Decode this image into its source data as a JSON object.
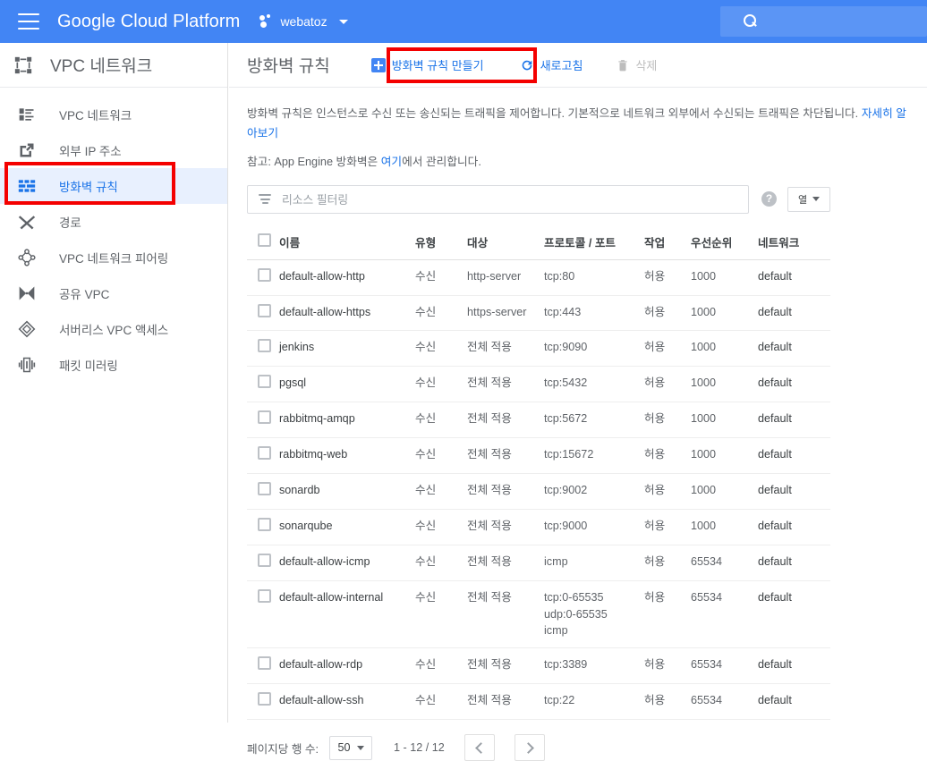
{
  "topbar": {
    "menu_icon": "hamburger-icon",
    "brand": "Google Cloud Platform",
    "project_icon": "project-dots-icon",
    "project_name": "webatoz",
    "project_caret": "chevron-down-icon",
    "search_icon": "search-icon",
    "search_value": "",
    "search_placeholder": ""
  },
  "sidebar": {
    "header_icon": "vpc-network-icon",
    "header_title": "VPC 네트워크",
    "items": [
      {
        "label": "VPC 네트워크",
        "icon": "vpc-network-list-icon",
        "selected": false
      },
      {
        "label": "외부 IP 주소",
        "icon": "external-ip-icon",
        "selected": false
      },
      {
        "label": "방화벽 규칙",
        "icon": "firewall-rules-icon",
        "selected": true
      },
      {
        "label": "경로",
        "icon": "routes-icon",
        "selected": false
      },
      {
        "label": "VPC 네트워크 피어링",
        "icon": "vpc-peering-icon",
        "selected": false
      },
      {
        "label": "공유 VPC",
        "icon": "shared-vpc-icon",
        "selected": false
      },
      {
        "label": "서버리스 VPC 액세스",
        "icon": "serverless-vpc-access-icon",
        "selected": false
      },
      {
        "label": "패킷 미러링",
        "icon": "packet-mirroring-icon",
        "selected": false
      }
    ]
  },
  "main": {
    "page_title": "방화벽 규칙",
    "toolbar": {
      "create_label": "방화벽 규칙 만들기",
      "create_icon": "plus-square-icon",
      "refresh_label": "새로고침",
      "refresh_icon": "refresh-icon",
      "delete_label": "삭제",
      "delete_icon": "trash-icon"
    },
    "description": {
      "line1": "방화벽 규칙은 인스턴스로 수신 또는 송신되는 트래픽을 제어합니다. 기본적으로 네트워크 외부에서 수신되는 트래픽은 차단됩니다. ",
      "learn_more": "자세히 알아보기",
      "note_prefix": "참고: App Engine 방화벽은 ",
      "note_link": "여기",
      "note_suffix": "에서 관리합니다."
    },
    "filter": {
      "icon": "filter-icon",
      "placeholder": "리소스 필터링",
      "value": "",
      "help_icon": "help-circle-icon",
      "columns_label": "열",
      "columns_icon": "columns-icon",
      "columns_caret": "chevron-down-icon"
    },
    "table": {
      "select_all_checkbox": "select-all-checkbox",
      "columns": [
        "이름",
        "유형",
        "대상",
        "프로토콜 / 포트",
        "작업",
        "우선순위",
        "네트워크"
      ],
      "rows": [
        {
          "name": "default-allow-http",
          "type": "수신",
          "target": "http-server",
          "protocol": "tcp:80",
          "action": "허용",
          "priority": "1000",
          "network": "default"
        },
        {
          "name": "default-allow-https",
          "type": "수신",
          "target": "https-server",
          "protocol": "tcp:443",
          "action": "허용",
          "priority": "1000",
          "network": "default"
        },
        {
          "name": "jenkins",
          "type": "수신",
          "target": "전체 적용",
          "protocol": "tcp:9090",
          "action": "허용",
          "priority": "1000",
          "network": "default"
        },
        {
          "name": "pgsql",
          "type": "수신",
          "target": "전체 적용",
          "protocol": "tcp:5432",
          "action": "허용",
          "priority": "1000",
          "network": "default"
        },
        {
          "name": "rabbitmq-amqp",
          "type": "수신",
          "target": "전체 적용",
          "protocol": "tcp:5672",
          "action": "허용",
          "priority": "1000",
          "network": "default"
        },
        {
          "name": "rabbitmq-web",
          "type": "수신",
          "target": "전체 적용",
          "protocol": "tcp:15672",
          "action": "허용",
          "priority": "1000",
          "network": "default"
        },
        {
          "name": "sonardb",
          "type": "수신",
          "target": "전체 적용",
          "protocol": "tcp:9002",
          "action": "허용",
          "priority": "1000",
          "network": "default"
        },
        {
          "name": "sonarqube",
          "type": "수신",
          "target": "전체 적용",
          "protocol": "tcp:9000",
          "action": "허용",
          "priority": "1000",
          "network": "default"
        },
        {
          "name": "default-allow-icmp",
          "type": "수신",
          "target": "전체 적용",
          "protocol": "icmp",
          "action": "허용",
          "priority": "65534",
          "network": "default"
        },
        {
          "name": "default-allow-internal",
          "type": "수신",
          "target": "전체 적용",
          "protocol": "tcp:0-65535\nudp:0-65535\nicmp",
          "action": "허용",
          "priority": "65534",
          "network": "default"
        },
        {
          "name": "default-allow-rdp",
          "type": "수신",
          "target": "전체 적용",
          "protocol": "tcp:3389",
          "action": "허용",
          "priority": "65534",
          "network": "default"
        },
        {
          "name": "default-allow-ssh",
          "type": "수신",
          "target": "전체 적용",
          "protocol": "tcp:22",
          "action": "허용",
          "priority": "65534",
          "network": "default"
        }
      ]
    },
    "pagination": {
      "rows_per_page_label": "페이지당 행 수:",
      "rows_per_page_value": "50",
      "range_text": "1 - 12 / 12",
      "prev_icon": "chevron-left-icon",
      "next_icon": "chevron-right-icon"
    }
  },
  "annotations": {
    "highlight_color": "#f40000",
    "boxes": [
      "firewall-rules-sidebar-item",
      "create-firewall-rule-button"
    ]
  },
  "colors": {
    "header_blue": "#4285f4",
    "search_blue": "#5b95f5",
    "accent_blue": "#1a73e8",
    "selected_bg": "#e8f0fe",
    "text_primary": "#3c4043",
    "text_secondary": "#5f6368"
  }
}
